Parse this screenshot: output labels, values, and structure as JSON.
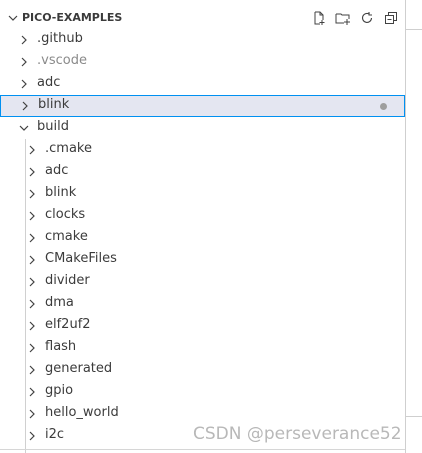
{
  "explorer": {
    "title": "PICO-EXAMPLES",
    "actions": [
      {
        "name": "new-file-icon"
      },
      {
        "name": "new-folder-icon"
      },
      {
        "name": "refresh-icon"
      },
      {
        "name": "collapse-all-icon"
      }
    ]
  },
  "tree": {
    "root_items": [
      ".github",
      ".vscode",
      "adc",
      "blink",
      "build"
    ],
    "build_children": [
      "cmake",
      "adc",
      "blink",
      "clocks",
      "cmake",
      "CMakeFiles",
      "divider",
      "dma",
      "elf2uf2",
      "flash",
      "generated",
      "gpio",
      "hello_world",
      "i2c"
    ],
    "cmake_hidden_label": ".cmake"
  },
  "watermark": "CSDN @perseverance52",
  "colors": {
    "selection_bg": "#e4e6f1",
    "selection_border": "#0090f1",
    "text": "#3b3b3b",
    "modified_dot": "#9e9e9e"
  }
}
